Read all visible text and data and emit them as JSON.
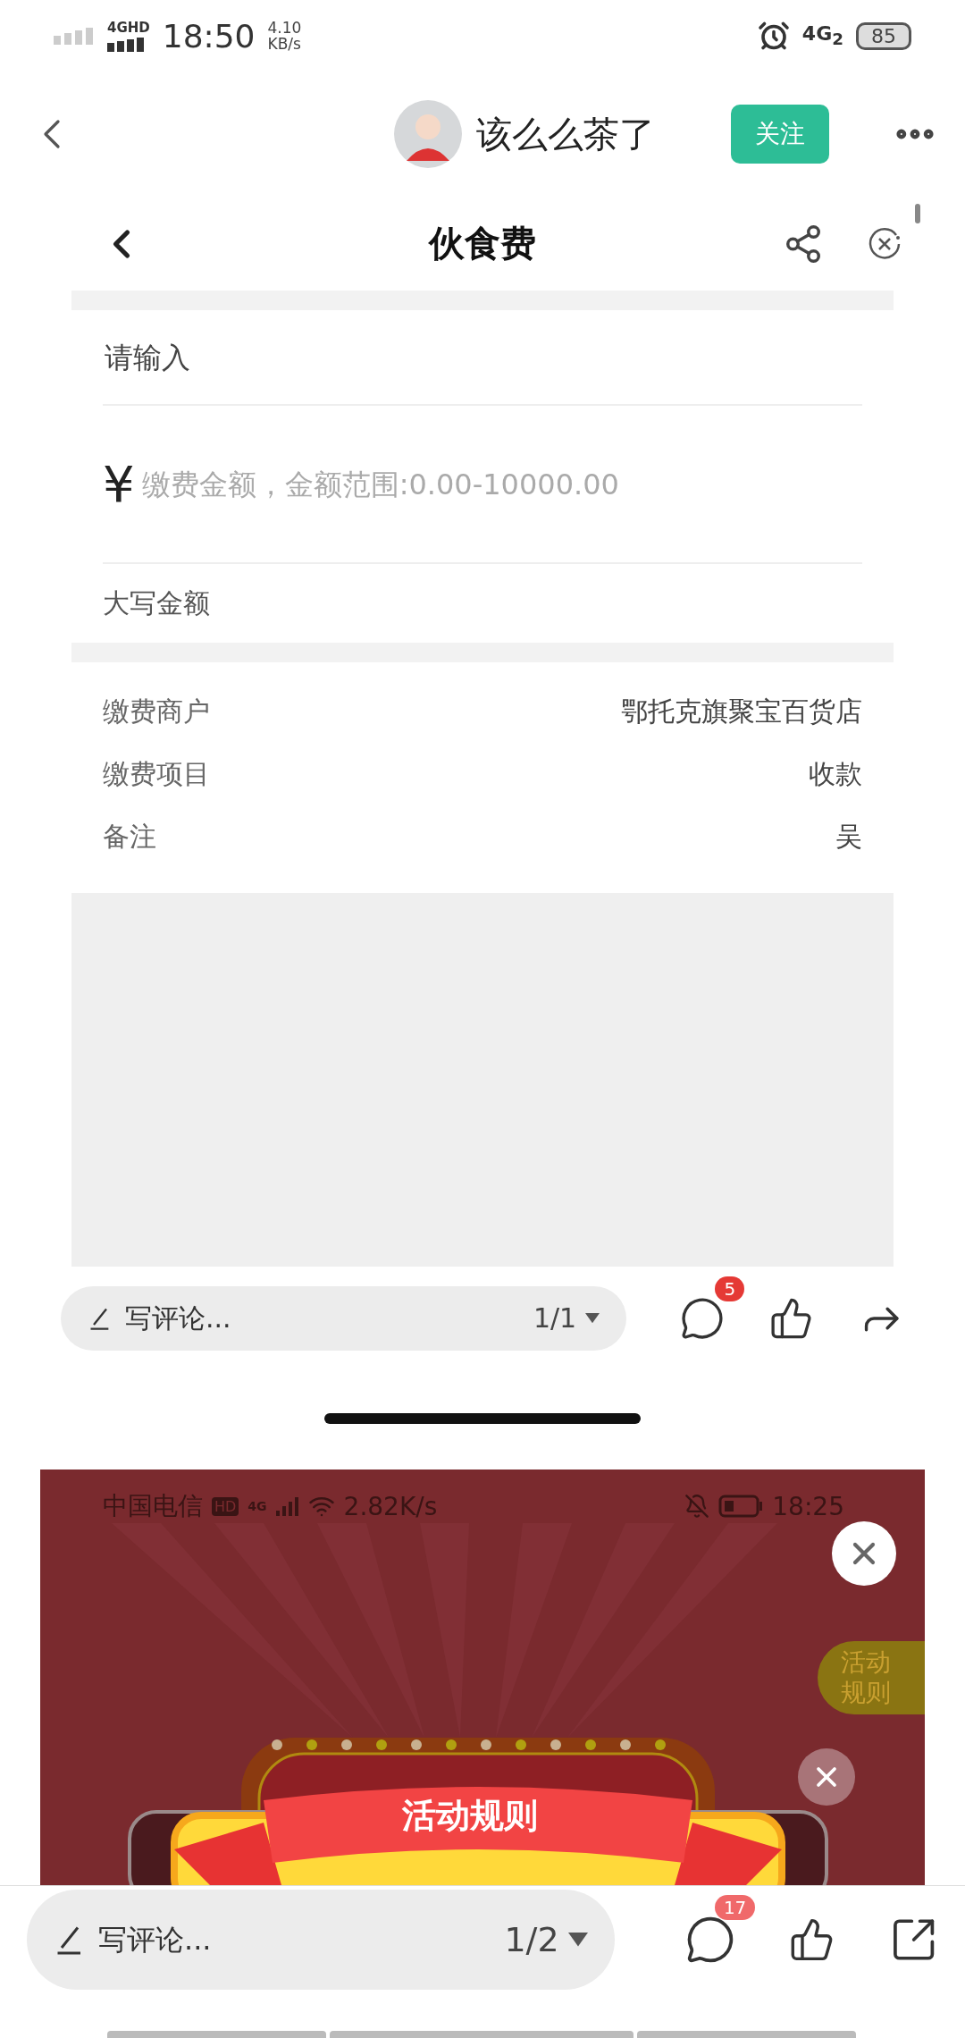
{
  "status_bar": {
    "network": "4GHD",
    "time": "18:50",
    "speed": "4.10",
    "speed_unit": "KB/s",
    "mobile": "4G$_{2}$",
    "battery": "85"
  },
  "header": {
    "author": "该么么茶了",
    "follow": "关注"
  },
  "payment_shot": {
    "title": "伙食费",
    "input_placeholder": "请输入",
    "currency": "¥",
    "amount_placeholder": "缴费金额，金额范围:0.00-10000.00",
    "uppercase_label": "大写金额",
    "info_rows": [
      {
        "label": "缴费商户",
        "value": "鄂托克旗聚宝百货店"
      },
      {
        "label": "缴费项目",
        "value": "收款"
      },
      {
        "label": "备注",
        "value": "吴"
      }
    ],
    "comment_bar": {
      "placeholder": "写评论...",
      "page": "1/1",
      "badge": "5"
    }
  },
  "promo_shot": {
    "status_bar": {
      "carrier": "中国电信",
      "hd": "HD",
      "network": "4G",
      "speed": "2.82K/s",
      "time": "18:25"
    },
    "side_tab": "活动规则",
    "ribbon": "活动规则"
  },
  "comment_bar": {
    "placeholder": "写评论...",
    "page": "1/2",
    "badge": "17"
  }
}
